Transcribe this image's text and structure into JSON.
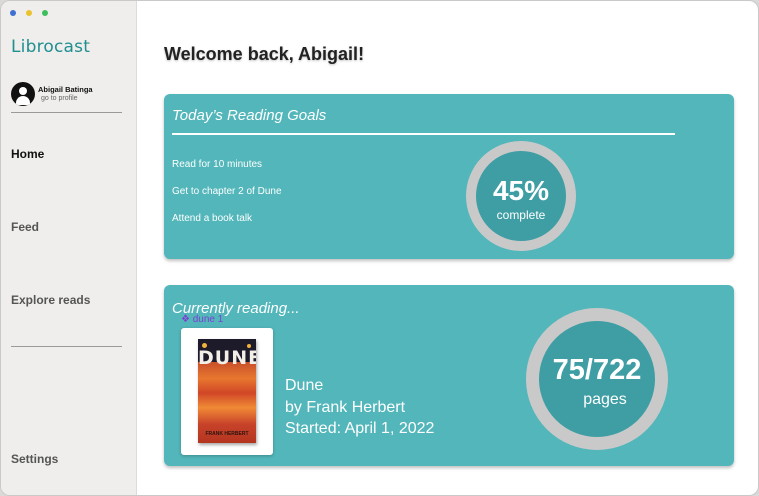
{
  "app": {
    "name": "Librocast"
  },
  "window_controls": {
    "close_color": "#3f6fd1",
    "minimize_color": "#e9c22e",
    "zoom_color": "#3cbf5a"
  },
  "profile": {
    "name": "Abigail Batinga",
    "link": "go to profile"
  },
  "nav": {
    "home": "Home",
    "feed": "Feed",
    "explore": "Explore reads",
    "settings": "Settings"
  },
  "main": {
    "welcome": "Welcome back, Abigail!"
  },
  "goals": {
    "title": "Today’s Reading Goals",
    "items": [
      "Read for 10 minutes",
      "Get to chapter 2 of Dune",
      "Attend a book talk"
    ],
    "progress_value": "45%",
    "progress_label": "complete",
    "progress_fraction": 0.45
  },
  "reading": {
    "title": "Currently reading...",
    "layer_label": "❖ dune 1",
    "book_title": "Dune",
    "book_author": "by Frank Herbert",
    "started": "Started: April 1, 2022",
    "pages_value": "75/722",
    "pages_label": "pages",
    "current_page": 75,
    "total_pages": 722,
    "cover": {
      "title": "DUNE",
      "author": "FRANK HERBERT"
    }
  },
  "colors": {
    "accent": "#52b6ba",
    "accent_dark": "#3e9ea3",
    "ring": "#c9c9c9",
    "brand": "#1f8f8f"
  }
}
